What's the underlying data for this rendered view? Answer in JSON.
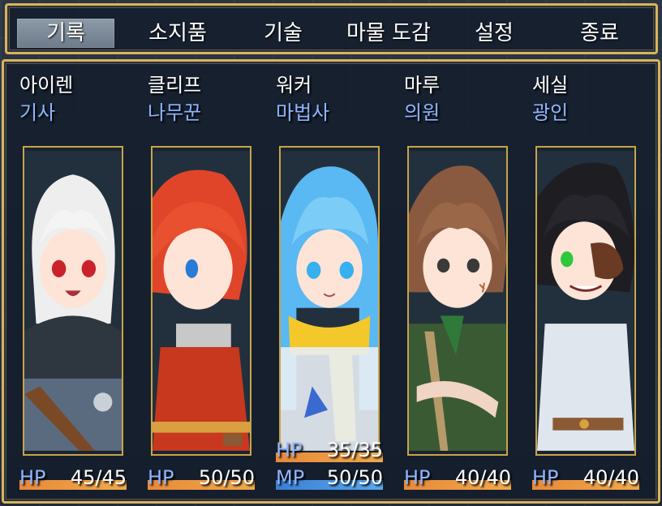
{
  "menu": {
    "items": [
      {
        "label": "기록",
        "selected": true
      },
      {
        "label": "소지품",
        "selected": false
      },
      {
        "label": "기술",
        "selected": false
      },
      {
        "label": "마물 도감",
        "selected": false
      },
      {
        "label": "설정",
        "selected": false
      },
      {
        "label": "종료",
        "selected": false
      }
    ]
  },
  "party": [
    {
      "name": "아이렌",
      "class": "기사",
      "portrait": "white-haired-knight",
      "gauges": [
        {
          "label": "HP",
          "value": "45/45",
          "current": 45,
          "max": 45
        }
      ]
    },
    {
      "name": "클리프",
      "class": "나무꾼",
      "portrait": "red-haired-woodcutter",
      "gauges": [
        {
          "label": "HP",
          "value": "50/50",
          "current": 50,
          "max": 50
        }
      ]
    },
    {
      "name": "워커",
      "class": "마법사",
      "portrait": "blue-haired-mage",
      "gauges": [
        {
          "label": "HP",
          "value": "35/35",
          "current": 35,
          "max": 35
        },
        {
          "label": "MP",
          "value": "50/50",
          "current": 50,
          "max": 50
        }
      ]
    },
    {
      "name": "마루",
      "class": "의원",
      "portrait": "brown-haired-healer",
      "gauges": [
        {
          "label": "HP",
          "value": "40/40",
          "current": 40,
          "max": 40
        }
      ]
    },
    {
      "name": "세실",
      "class": "광인",
      "portrait": "black-haired-eyepatch",
      "gauges": [
        {
          "label": "HP",
          "value": "40/40",
          "current": 40,
          "max": 40
        }
      ]
    }
  ],
  "colors": {
    "border": "#d8b45a",
    "class_text": "#8fb4ff",
    "hp_bar": "#e88a3a",
    "mp_bar": "#3a7fd4"
  }
}
